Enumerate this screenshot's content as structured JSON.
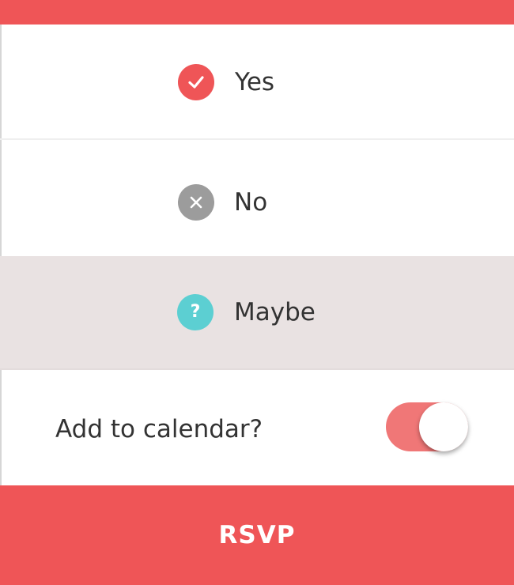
{
  "options": [
    {
      "label": "Yes",
      "icon": "check-icon",
      "color": "#ef5557",
      "selected": false
    },
    {
      "label": "No",
      "icon": "close-icon",
      "color": "#9c9c9c",
      "selected": false
    },
    {
      "label": "Maybe",
      "icon": "question-icon",
      "color": "#5ccfd2",
      "selected": true
    }
  ],
  "icons": {
    "question_glyph": "?"
  },
  "calendar": {
    "label": "Add to calendar?",
    "enabled": true
  },
  "rsvp": {
    "label": "RSVP"
  },
  "colors": {
    "accent": "#ef5557",
    "toggle_track": "#f07777",
    "selected_row": "#e9e2e2"
  }
}
